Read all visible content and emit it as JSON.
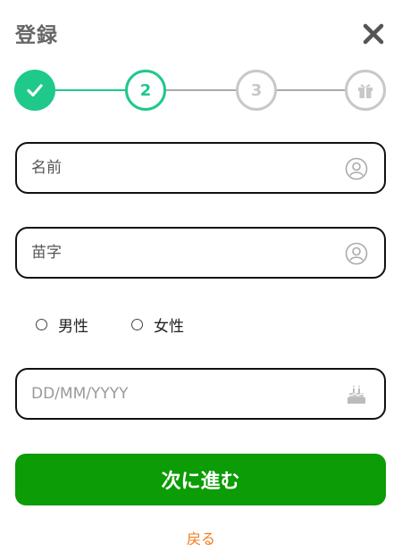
{
  "header": {
    "title": "登録"
  },
  "steps": [
    {
      "state": "done",
      "label": ""
    },
    {
      "state": "active",
      "label": "2"
    },
    {
      "state": "todo",
      "label": "3"
    },
    {
      "state": "todo",
      "label": ""
    }
  ],
  "icons": {
    "close": "close-icon",
    "check": "check-icon",
    "gift": "gift-icon",
    "user": "user-circle-icon",
    "cake": "birthday-cake-icon"
  },
  "form": {
    "first_name": {
      "placeholder": "名前",
      "value": ""
    },
    "last_name": {
      "placeholder": "苗字",
      "value": ""
    },
    "gender": {
      "male_label": "男性",
      "female_label": "女性"
    },
    "birthday": {
      "placeholder": "DD/MM/YYYY",
      "value": ""
    }
  },
  "actions": {
    "next_label": "次に進む",
    "back_label": "戻る"
  },
  "colors": {
    "accent_green": "#1ec98a",
    "button_green": "#0c9c05",
    "inactive": "#c8c8c8",
    "link_orange": "#f27a1a"
  }
}
